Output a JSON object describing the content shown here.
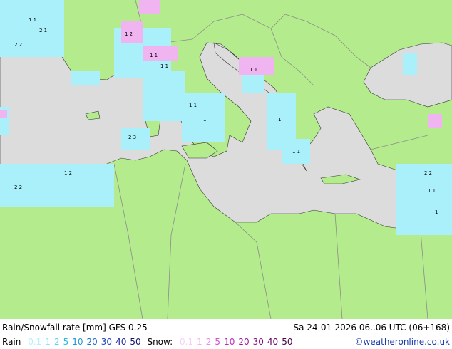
{
  "title": "Rain/Snowfall rate [mm] GFS 0.25",
  "valid": "Sa 24-01-2026 06..06 UTC (06+168)",
  "credit": "©weatheronline.co.uk",
  "rain_legend": {
    "label": "Rain",
    "levels": [
      {
        "text": "0.1",
        "color": "#b4f0fa"
      },
      {
        "text": "1",
        "color": "#8ce6f5"
      },
      {
        "text": "2",
        "color": "#5ad2eb"
      },
      {
        "text": "5",
        "color": "#28bedc"
      },
      {
        "text": "10",
        "color": "#1e96d2"
      },
      {
        "text": "20",
        "color": "#1e6ec8"
      },
      {
        "text": "30",
        "color": "#1e46be"
      },
      {
        "text": "40",
        "color": "#1e28a0"
      },
      {
        "text": "50",
        "color": "#14146e"
      }
    ]
  },
  "snow_legend": {
    "label": "Snow:",
    "levels": [
      {
        "text": "0.1",
        "color": "#f5d2f5"
      },
      {
        "text": "1",
        "color": "#f0b4f0"
      },
      {
        "text": "2",
        "color": "#e68ce6"
      },
      {
        "text": "5",
        "color": "#d250d2"
      },
      {
        "text": "10",
        "color": "#be28be"
      },
      {
        "text": "20",
        "color": "#a014a0"
      },
      {
        "text": "30",
        "color": "#820a82"
      },
      {
        "text": "40",
        "color": "#640064"
      },
      {
        "text": "50",
        "color": "#460046"
      }
    ]
  },
  "colors": {
    "land": "#b4eb8c",
    "sea": "#dcdcdc",
    "border": "#8c8c8c",
    "coast": "#000000",
    "rain": "#aaf0fa",
    "snow": "#f0b4f0"
  }
}
